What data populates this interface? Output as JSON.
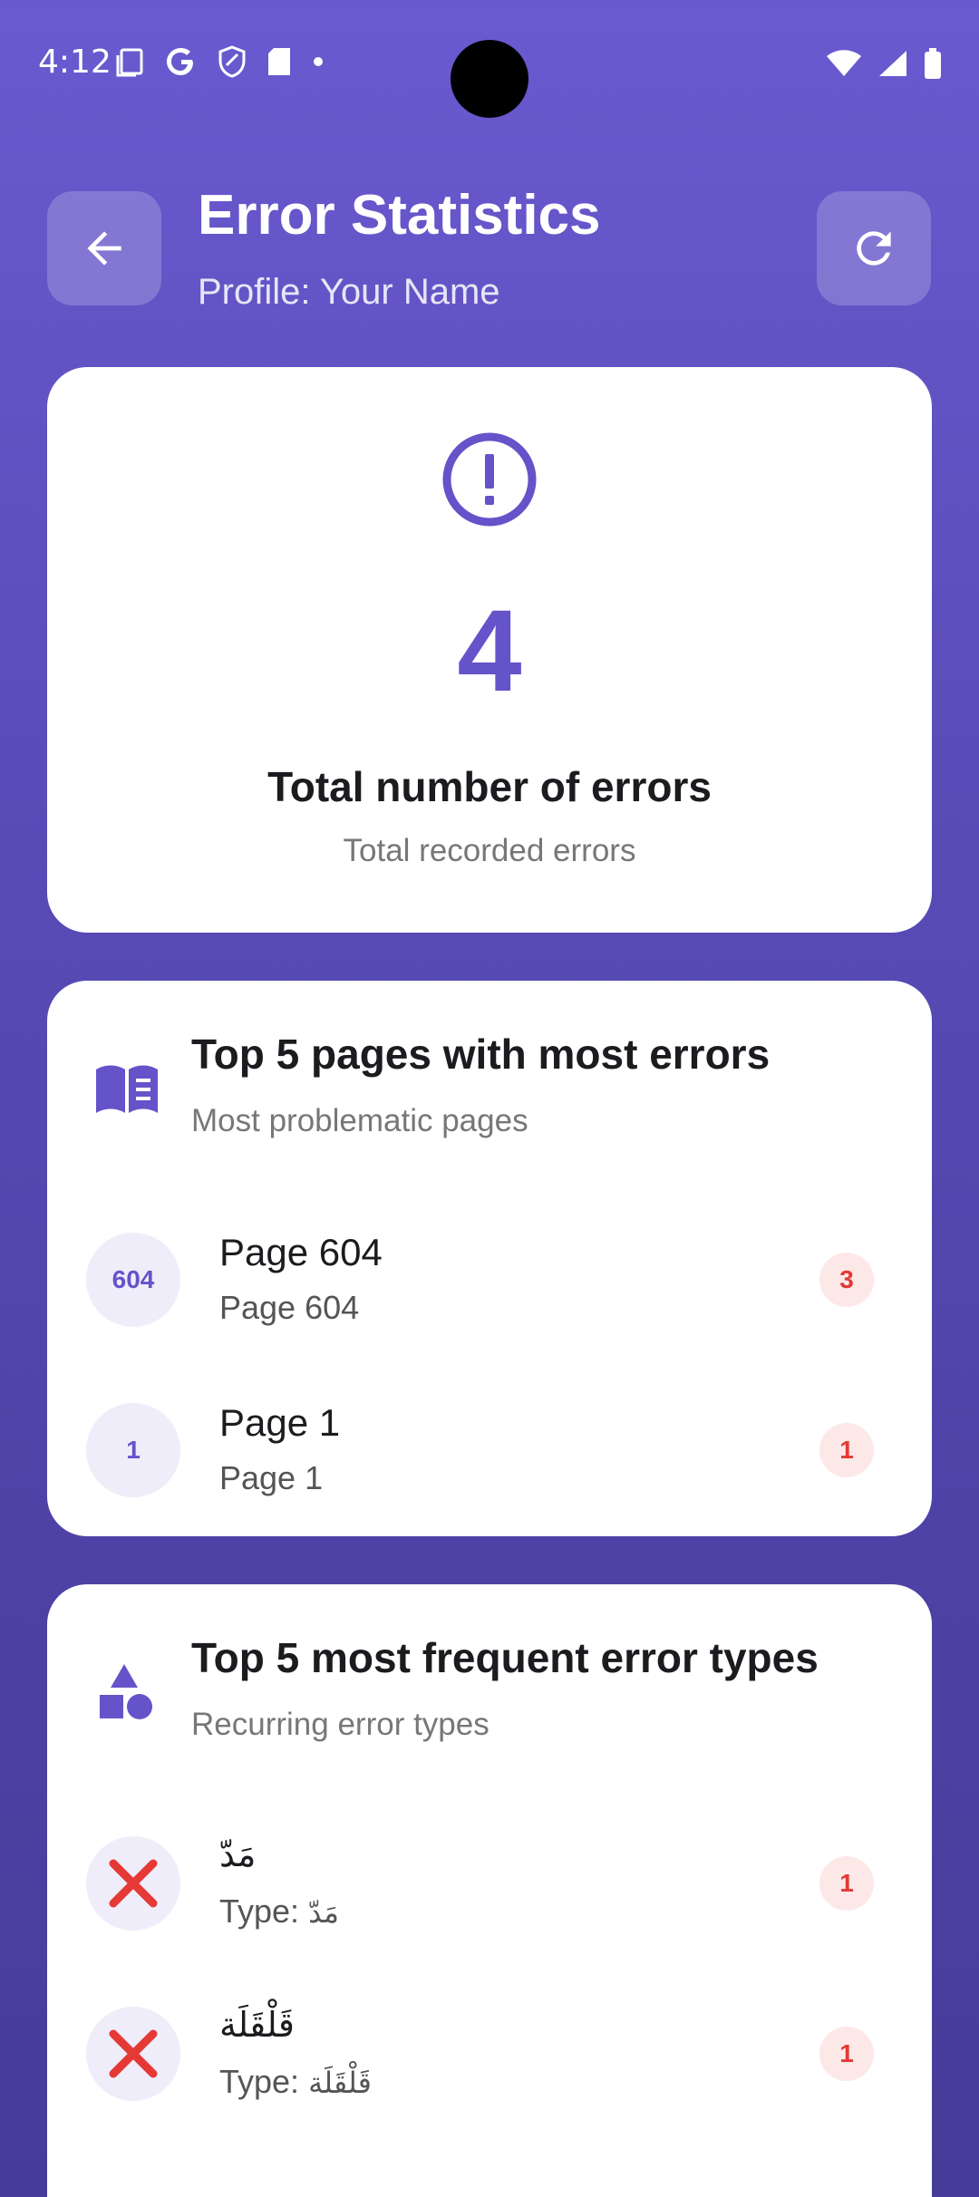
{
  "status_bar": {
    "time": "4:12"
  },
  "header": {
    "title": "Error Statistics",
    "subtitle": "Profile: Your Name"
  },
  "total_card": {
    "value": "4",
    "title": "Total number of errors",
    "subtitle": "Total recorded errors"
  },
  "pages_card": {
    "title": "Top 5 pages with most errors",
    "subtitle": "Most problematic pages",
    "items": [
      {
        "badge": "604",
        "title": "Page 604",
        "subtitle": "Page 604",
        "count": "3"
      },
      {
        "badge": "1",
        "title": "Page 1",
        "subtitle": "Page 1",
        "count": "1"
      }
    ]
  },
  "types_card": {
    "title": "Top 5 most frequent error types",
    "subtitle": "Recurring error types",
    "items": [
      {
        "title": "مَدّ",
        "subtitle_prefix": "Type: ",
        "subtitle_value": "مَدّ",
        "count": "1"
      },
      {
        "title": "قَلْقَلَة",
        "subtitle_prefix": "Type: ",
        "subtitle_value": "قَلْقَلَة",
        "count": "1"
      }
    ]
  },
  "colors": {
    "accent": "#6553c9",
    "error_red": "#e53935",
    "background_top": "#6a5ad0",
    "background_bottom": "#473b99"
  }
}
